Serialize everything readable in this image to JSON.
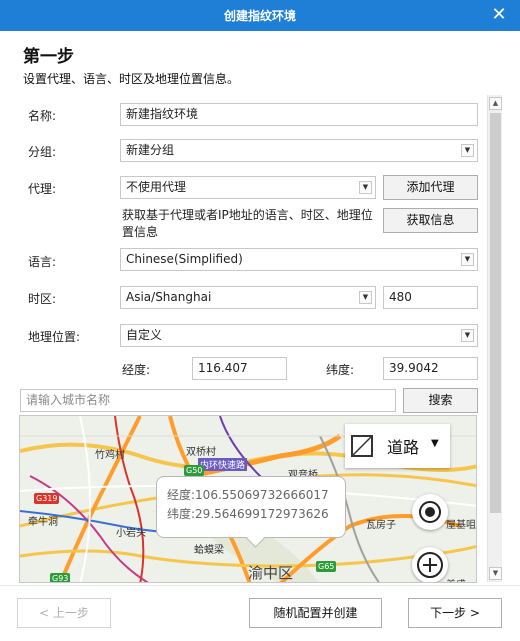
{
  "window": {
    "title": "创建指纹环境",
    "close_glyph": "✕"
  },
  "header": {
    "step_title": "第一步",
    "step_desc": "设置代理、语言、时区及地理位置信息。"
  },
  "form": {
    "name": {
      "label": "名称:",
      "value": "新建指纹环境"
    },
    "group": {
      "label": "分组:",
      "value": "新建分组"
    },
    "proxy": {
      "label": "代理:",
      "value": "不使用代理",
      "add_button": "添加代理"
    },
    "fetch": {
      "hint": "获取基于代理或者IP地址的语言、时区、地理位置信息",
      "button": "获取信息"
    },
    "language": {
      "label": "语言:",
      "value": "Chinese(Simplified)"
    },
    "timezone": {
      "label": "时区:",
      "value": "Asia/Shanghai",
      "offset": "480"
    },
    "geo": {
      "label": "地理位置:",
      "value": "自定义"
    },
    "longitude": {
      "label": "经度:",
      "value": "116.407"
    },
    "latitude": {
      "label": "纬度:",
      "value": "39.9042"
    },
    "city_search": {
      "placeholder": "请输入城市名称",
      "button": "搜索"
    }
  },
  "map": {
    "layer_label": "道路",
    "tooltip": {
      "lng_line": "经度:106.55069732666017",
      "lat_line": "纬度:29.564699172973626"
    },
    "places": [
      "竹鸡村",
      "双桥村",
      "观音桥",
      "内环快速路",
      "牵牛洞",
      "小岩头",
      "蛤蟆梁",
      "渝中区",
      "瓦房子",
      "屋基咀",
      "美盛"
    ],
    "shields": [
      "G50",
      "G319",
      "G93",
      "G65"
    ]
  },
  "footer": {
    "prev": "< 上一步",
    "random_create": "随机配置并创建",
    "next": "下一步 >"
  },
  "colors": {
    "titlebar": "#1f7fd6",
    "map_bg": "#eef0ea",
    "highway": "#ff9c2a",
    "shield_green": "#2e9b3a",
    "shield_red": "#d9342b"
  }
}
